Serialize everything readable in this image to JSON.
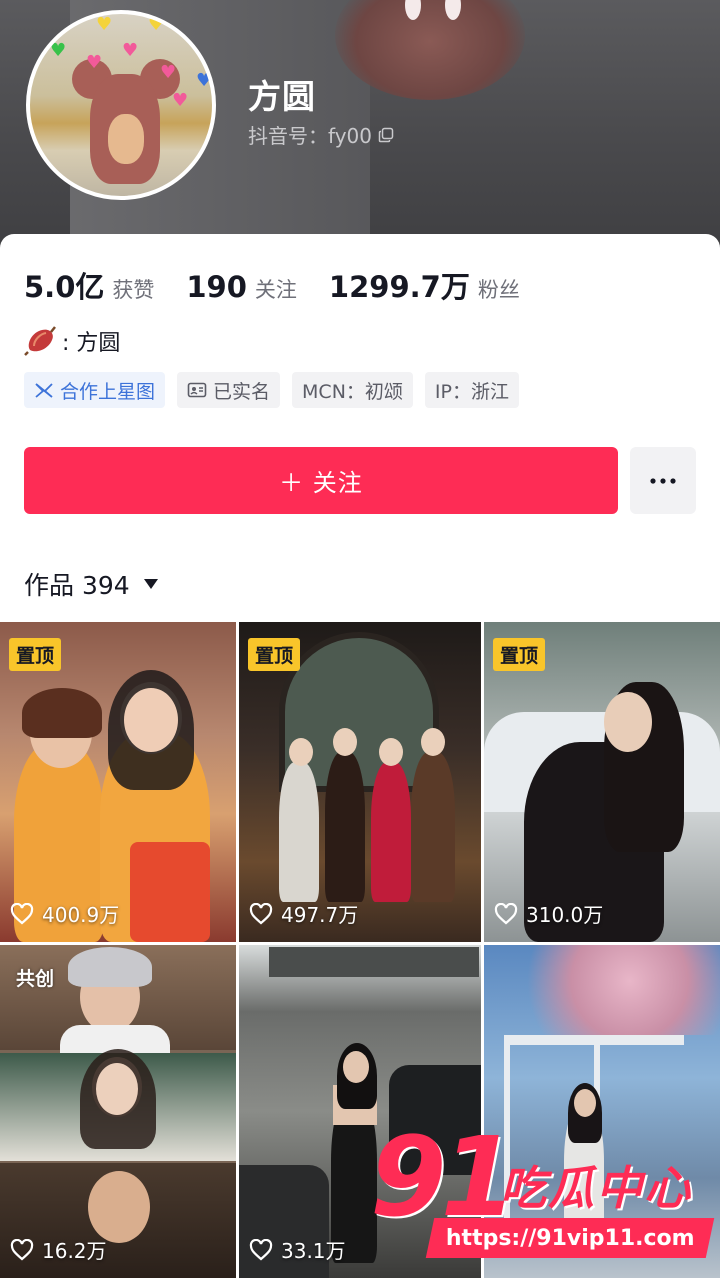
{
  "profile": {
    "name": "方圆",
    "douyin_id": "抖音号：fy00"
  },
  "stats": [
    {
      "value": "5.0亿",
      "label": "获赞"
    },
    {
      "value": "190",
      "label": "关注"
    },
    {
      "value": "1299.7万",
      "label": "粉丝"
    }
  ],
  "bio": {
    "text": ": 方圆",
    "icon": "sweet-potato-icon"
  },
  "tags": [
    {
      "label": "合作上星图",
      "icon": "star-map-icon"
    },
    {
      "label": "已实名",
      "icon": "id-card-icon"
    },
    {
      "label": "MCN：初颂"
    },
    {
      "label": "IP：浙江"
    }
  ],
  "actions": {
    "follow_label": "＋ 关注",
    "more_icon": "more-dots-icon"
  },
  "works": {
    "label": "作品 394"
  },
  "videos": [
    {
      "badge": "置顶",
      "likes": "400.9万"
    },
    {
      "badge": "置顶",
      "likes": "497.7万"
    },
    {
      "badge": "置顶",
      "likes": "310.0万"
    },
    {
      "badge": "共创",
      "likes": "16.2万"
    },
    {
      "badge": "",
      "likes": "33.1万"
    },
    {
      "badge": "",
      "likes": ""
    }
  ],
  "watermark": {
    "brand": "91",
    "text": "吃瓜中心",
    "url": "https://91vip11.com"
  },
  "colors": {
    "accent": "#fe2c55",
    "badge": "#f9c52a",
    "link": "#3d73d9"
  }
}
